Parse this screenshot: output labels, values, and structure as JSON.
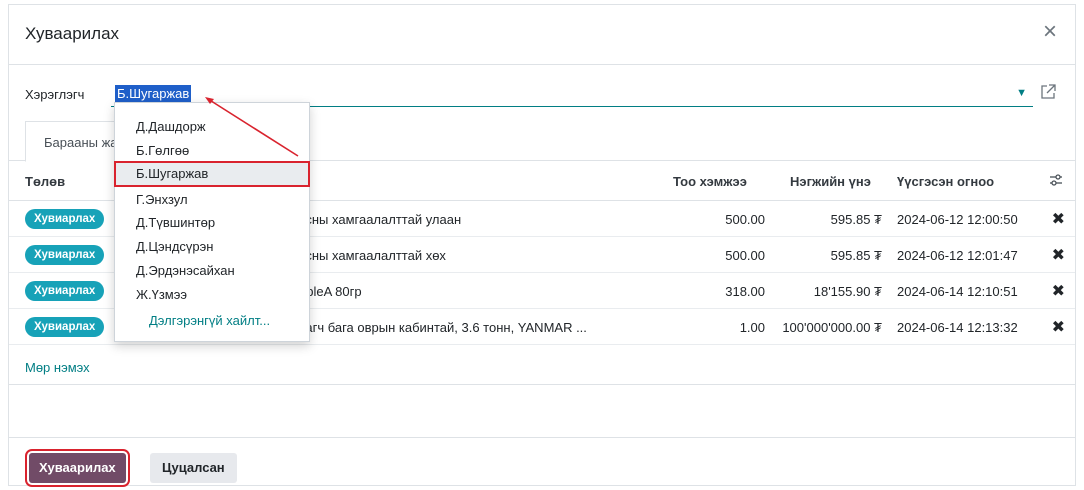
{
  "dialog": {
    "title": "Хуваарилах",
    "close_symbol": "×"
  },
  "user_field": {
    "label": "Хэрэглэгч",
    "value": "Б.Шугаржав"
  },
  "tabs": [
    {
      "label": "Барааны жагсаалт"
    }
  ],
  "table": {
    "columns": {
      "status": "Төлөв",
      "qty": "Тоо хэмжээ",
      "unit_price": "Нэгжийн үнэ",
      "created": "Үүсгэсэн огноо"
    },
    "rows": [
      {
        "status": "Хувиарлах",
        "product": "усны хамгаалалттай улаан",
        "qty": "500.00",
        "price": "595.85 ₮",
        "date": "2024-06-12 12:00:50"
      },
      {
        "status": "Хувиарлах",
        "product": "усны хамгаалалттай хөх",
        "qty": "500.00",
        "price": "595.85 ₮",
        "date": "2024-06-12 12:01:47"
      },
      {
        "status": "Хувиарлах",
        "product": "ubleA 80гр",
        "qty": "318.00",
        "price": "18'155.90 ₮",
        "date": "2024-06-14 12:10:51"
      },
      {
        "status": "Хувиарлах",
        "product": "хагч бага оврын кабинтай, 3.6 тонн, YANMAR ...",
        "qty": "1.00",
        "price": "100'000'000.00 ₮",
        "date": "2024-06-14 12:13:32"
      }
    ],
    "delete_symbol": "✖",
    "add_line": "Мөр нэмэх"
  },
  "dropdown": {
    "items": [
      "Д.Дашдорж",
      "Б.Гөлгөө",
      "Б.Шугаржав",
      "Г.Энхзул",
      "Д.Түвшинтөр",
      "Д.Цэндсүрэн",
      "Д.Эрдэнэсайхан",
      "Ж.Үзмээ"
    ],
    "selected": "Б.Шугаржав",
    "more": "Дэлгэрэнгүй хайлт..."
  },
  "footer": {
    "primary": "Хуваарилах",
    "secondary": "Цуцалсан"
  },
  "colors": {
    "primary": "#714b67",
    "badge": "#17a2b8",
    "accent": "#017e84",
    "highlight": "#d9232e"
  }
}
